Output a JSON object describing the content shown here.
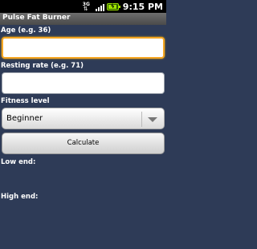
{
  "status_bar": {
    "network_label": "3G",
    "time": "9:15 PM",
    "icons": [
      "3g-data-icon",
      "signal-icon",
      "battery-charging-icon"
    ]
  },
  "app": {
    "title": "Pulse Fat Burner"
  },
  "form": {
    "age": {
      "label": "Age (e.g. 36)",
      "value": ""
    },
    "resting": {
      "label": "Resting rate (e.g. 71)",
      "value": ""
    },
    "fitness": {
      "label": "Fitness level",
      "selected": "Beginner"
    },
    "calculate_label": "Calculate"
  },
  "results": {
    "low_label": "Low end:",
    "high_label": "High end:"
  },
  "colors": {
    "background": "#2e3b57",
    "focus_border": "#f5a623",
    "title_bar": "#5a5a5a"
  }
}
